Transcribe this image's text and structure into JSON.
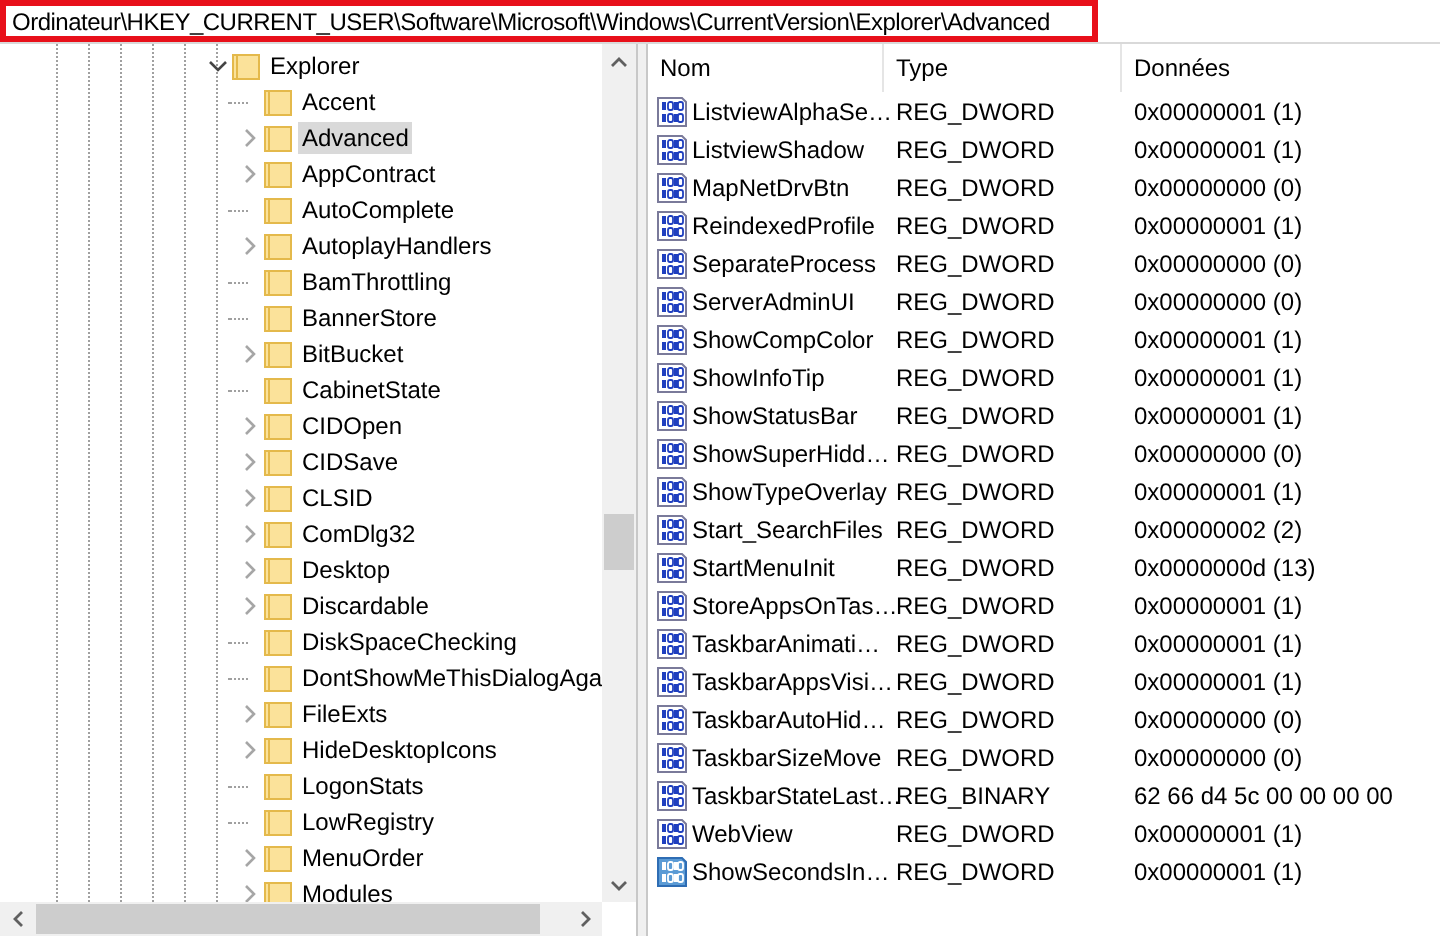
{
  "address": {
    "path": "Ordinateur\\HKEY_CURRENT_USER\\Software\\Microsoft\\Windows\\CurrentVersion\\Explorer\\Advanced",
    "highlighted": true
  },
  "tree": {
    "items": [
      {
        "label": "Explorer",
        "expanded": true,
        "selected": false,
        "children": [
          {
            "label": "Accent",
            "has_children": false,
            "selected": false
          },
          {
            "label": "Advanced",
            "has_children": true,
            "selected": true
          },
          {
            "label": "AppContract",
            "has_children": true,
            "selected": false
          },
          {
            "label": "AutoComplete",
            "has_children": false,
            "selected": false
          },
          {
            "label": "AutoplayHandlers",
            "has_children": true,
            "selected": false
          },
          {
            "label": "BamThrottling",
            "has_children": false,
            "selected": false
          },
          {
            "label": "BannerStore",
            "has_children": false,
            "selected": false
          },
          {
            "label": "BitBucket",
            "has_children": true,
            "selected": false
          },
          {
            "label": "CabinetState",
            "has_children": false,
            "selected": false
          },
          {
            "label": "CIDOpen",
            "has_children": true,
            "selected": false
          },
          {
            "label": "CIDSave",
            "has_children": true,
            "selected": false
          },
          {
            "label": "CLSID",
            "has_children": true,
            "selected": false
          },
          {
            "label": "ComDlg32",
            "has_children": true,
            "selected": false
          },
          {
            "label": "Desktop",
            "has_children": true,
            "selected": false
          },
          {
            "label": "Discardable",
            "has_children": true,
            "selected": false
          },
          {
            "label": "DiskSpaceChecking",
            "has_children": false,
            "selected": false
          },
          {
            "label": "DontShowMeThisDialogAga",
            "has_children": false,
            "selected": false
          },
          {
            "label": "FileExts",
            "has_children": true,
            "selected": false
          },
          {
            "label": "HideDesktopIcons",
            "has_children": true,
            "selected": false
          },
          {
            "label": "LogonStats",
            "has_children": false,
            "selected": false
          },
          {
            "label": "LowRegistry",
            "has_children": false,
            "selected": false
          },
          {
            "label": "MenuOrder",
            "has_children": true,
            "selected": false
          },
          {
            "label": "Modules",
            "has_children": true,
            "selected": false
          }
        ]
      }
    ]
  },
  "values": {
    "columns": [
      "Nom",
      "Type",
      "Données"
    ],
    "rows": [
      {
        "name": "ListviewAlphaSe…",
        "type": "REG_DWORD",
        "data": "0x00000001 (1)",
        "selected": false
      },
      {
        "name": "ListviewShadow",
        "type": "REG_DWORD",
        "data": "0x00000001 (1)",
        "selected": false
      },
      {
        "name": "MapNetDrvBtn",
        "type": "REG_DWORD",
        "data": "0x00000000 (0)",
        "selected": false
      },
      {
        "name": "ReindexedProfile",
        "type": "REG_DWORD",
        "data": "0x00000001 (1)",
        "selected": false
      },
      {
        "name": "SeparateProcess",
        "type": "REG_DWORD",
        "data": "0x00000000 (0)",
        "selected": false
      },
      {
        "name": "ServerAdminUI",
        "type": "REG_DWORD",
        "data": "0x00000000 (0)",
        "selected": false
      },
      {
        "name": "ShowCompColor",
        "type": "REG_DWORD",
        "data": "0x00000001 (1)",
        "selected": false
      },
      {
        "name": "ShowInfoTip",
        "type": "REG_DWORD",
        "data": "0x00000001 (1)",
        "selected": false
      },
      {
        "name": "ShowStatusBar",
        "type": "REG_DWORD",
        "data": "0x00000001 (1)",
        "selected": false
      },
      {
        "name": "ShowSuperHidd…",
        "type": "REG_DWORD",
        "data": "0x00000000 (0)",
        "selected": false
      },
      {
        "name": "ShowTypeOverlay",
        "type": "REG_DWORD",
        "data": "0x00000001 (1)",
        "selected": false
      },
      {
        "name": "Start_SearchFiles",
        "type": "REG_DWORD",
        "data": "0x00000002 (2)",
        "selected": false
      },
      {
        "name": "StartMenuInit",
        "type": "REG_DWORD",
        "data": "0x0000000d (13)",
        "selected": false
      },
      {
        "name": "StoreAppsOnTas…",
        "type": "REG_DWORD",
        "data": "0x00000001 (1)",
        "selected": false
      },
      {
        "name": "TaskbarAnimati…",
        "type": "REG_DWORD",
        "data": "0x00000001 (1)",
        "selected": false
      },
      {
        "name": "TaskbarAppsVisi…",
        "type": "REG_DWORD",
        "data": "0x00000001 (1)",
        "selected": false
      },
      {
        "name": "TaskbarAutoHid…",
        "type": "REG_DWORD",
        "data": "0x00000000 (0)",
        "selected": false
      },
      {
        "name": "TaskbarSizeMove",
        "type": "REG_DWORD",
        "data": "0x00000000 (0)",
        "selected": false
      },
      {
        "name": "TaskbarStateLast…",
        "type": "REG_BINARY",
        "data": "62 66 d4 5c 00 00 00 00",
        "selected": false
      },
      {
        "name": "WebView",
        "type": "REG_DWORD",
        "data": "0x00000001 (1)",
        "selected": false
      },
      {
        "name": "ShowSecondsIn…",
        "type": "REG_DWORD",
        "data": "0x00000001 (1)",
        "selected": true
      }
    ]
  }
}
